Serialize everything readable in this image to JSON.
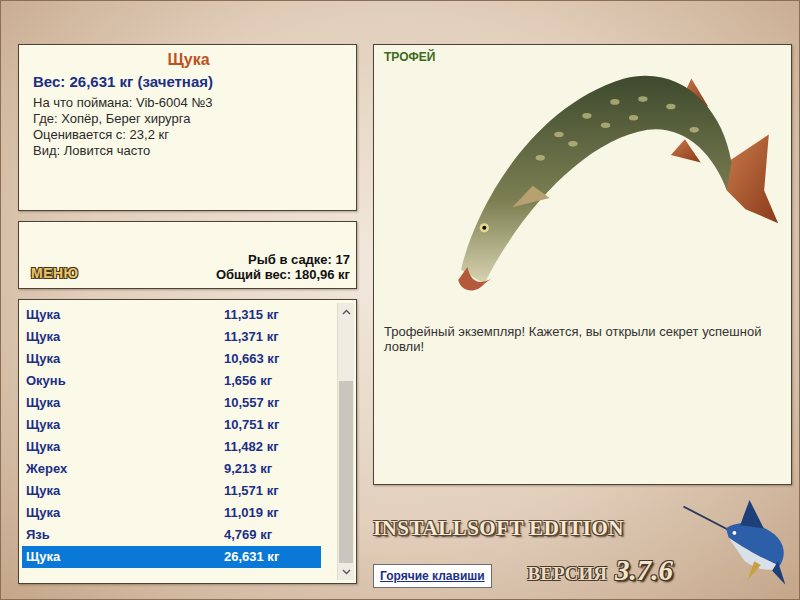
{
  "fish_card": {
    "name": "Щука",
    "weight": "Вес: 26,631 кг (зачетная)",
    "details": [
      "На что поймана: Vib-6004 №3",
      "Где: Хопёр, Берег хирурга",
      "Оценивается с: 23,2 кг",
      "Вид: Ловится часто"
    ]
  },
  "menu_button": "МЕНЮ",
  "keepnet": {
    "count": "Рыб в садке: 17",
    "total": "Общий вес: 180,96 кг"
  },
  "catch_list": {
    "scroll_position": 1,
    "rows": [
      {
        "name": "Щука",
        "weight": "11,315 кг",
        "selected": false
      },
      {
        "name": "Щука",
        "weight": "11,371 кг",
        "selected": false
      },
      {
        "name": "Щука",
        "weight": "10,663 кг",
        "selected": false
      },
      {
        "name": "Окунь",
        "weight": "1,656 кг",
        "selected": false
      },
      {
        "name": "Щука",
        "weight": "10,557 кг",
        "selected": false
      },
      {
        "name": "Щука",
        "weight": "10,751 кг",
        "selected": false
      },
      {
        "name": "Щука",
        "weight": "11,482 кг",
        "selected": false
      },
      {
        "name": "Жерех",
        "weight": "9,213 кг",
        "selected": false
      },
      {
        "name": "Щука",
        "weight": "11,571 кг",
        "selected": false
      },
      {
        "name": "Щука",
        "weight": "11,019 кг",
        "selected": false
      },
      {
        "name": "Язь",
        "weight": "4,769 кг",
        "selected": false
      },
      {
        "name": "Щука",
        "weight": "26,631 кг",
        "selected": true
      }
    ]
  },
  "trophy": {
    "label": "ТРОФЕЙ",
    "message": "Трофейный экземпляр! Кажется, вы открыли секрет успешной ловли!"
  },
  "brand": {
    "edition": "INSTALLSOFT EDITION",
    "version_label": "ВЕРСИЯ",
    "version": "3.7.6"
  },
  "hotkeys_button": "Горячие клавиши"
}
